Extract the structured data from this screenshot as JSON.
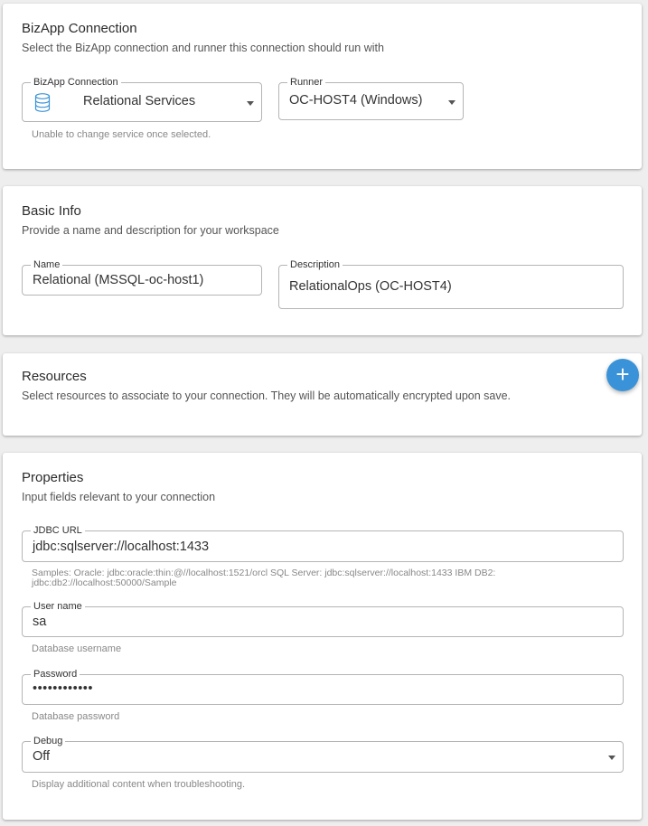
{
  "bizapp_section": {
    "title": "BizApp Connection",
    "subtitle": "Select the BizApp connection and runner this connection should run with",
    "connection_label": "BizApp Connection",
    "connection_value": "Relational Services",
    "connection_icon": "database-icon",
    "runner_label": "Runner",
    "runner_value": "OC-HOST4 (Windows)",
    "helper": "Unable to change service once selected."
  },
  "basic_info": {
    "title": "Basic Info",
    "subtitle": "Provide a name and description for your workspace",
    "name_label": "Name",
    "name_value": "Relational (MSSQL-oc-host1)",
    "description_label": "Description",
    "description_value": "RelationalOps (OC-HOST4)"
  },
  "resources": {
    "title": "Resources",
    "subtitle": "Select resources to associate to your connection. They will be automatically encrypted upon save.",
    "add_button_icon": "plus-icon",
    "add_button_glyph": "+"
  },
  "properties": {
    "title": "Properties",
    "subtitle": "Input fields relevant to your connection",
    "jdbc_label": "JDBC URL",
    "jdbc_value": "jdbc:sqlserver://localhost:1433",
    "jdbc_helper_line1": "Samples: Oracle: jdbc:oracle:thin:@//localhost:1521/orcl SQL Server: jdbc:sqlserver://localhost:1433 IBM DB2:",
    "jdbc_helper_line2": "jdbc:db2://localhost:50000/Sample",
    "username_label": "User name",
    "username_value": "sa",
    "username_helper": "Database username",
    "password_label": "Password",
    "password_value": "••••••••••••",
    "password_helper": "Database password",
    "debug_label": "Debug",
    "debug_value": "Off",
    "debug_helper": "Display additional content when troubleshooting."
  },
  "colors": {
    "accent": "#3a93d8",
    "background": "#eeeeee",
    "card": "#ffffff"
  }
}
